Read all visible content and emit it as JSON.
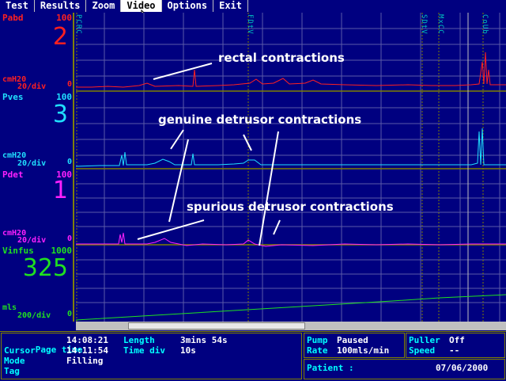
{
  "menu": [
    "Test",
    "Results",
    "Zoom",
    "Video",
    "Options",
    "Exit"
  ],
  "channels": [
    {
      "name": "Pabd",
      "max": "100",
      "big": "2",
      "unit": "cmH20",
      "div": "20/div",
      "min": "0",
      "color": "#ff2020"
    },
    {
      "name": "Pves",
      "max": "100",
      "big": "3",
      "unit": "cmH20",
      "div": "20/div",
      "min": "0",
      "color": "#20e0ff"
    },
    {
      "name": "Pdet",
      "max": "100",
      "big": "1",
      "unit": "cmH20",
      "div": "20/div",
      "min": "0",
      "color": "#ff20ff"
    },
    {
      "name": "Vinfus",
      "max": "1000",
      "big": "325",
      "unit": "mls",
      "div": "200/div",
      "min": "0",
      "color": "#20e020"
    }
  ],
  "events": [
    "PCRC",
    "FDtV",
    "SDtV",
    "MxCC",
    "CoUb"
  ],
  "annotations": {
    "rectal": "rectal contractions",
    "genuine": "genuine detrusor contractions",
    "spurious": "spurious detrusor contractions"
  },
  "status": {
    "page_time_label": "Page time",
    "page_time": "14:08:21",
    "length_label": "Length",
    "length": "3mins 54s",
    "cursor_label": "Cursor",
    "cursor": "14:11:54",
    "timediv_label": "Time div",
    "timediv": "10s",
    "mode_label": "Mode",
    "mode": "Filling",
    "tag_label": "Tag",
    "pump_label": "Pump",
    "pump": "Paused",
    "rate_label": "Rate",
    "rate": "100mls/min",
    "puller_label": "Puller",
    "puller": "Off",
    "speed_label": "Speed",
    "speed": "--",
    "patient_label": "Patient :",
    "date": "07/06/2000"
  }
}
